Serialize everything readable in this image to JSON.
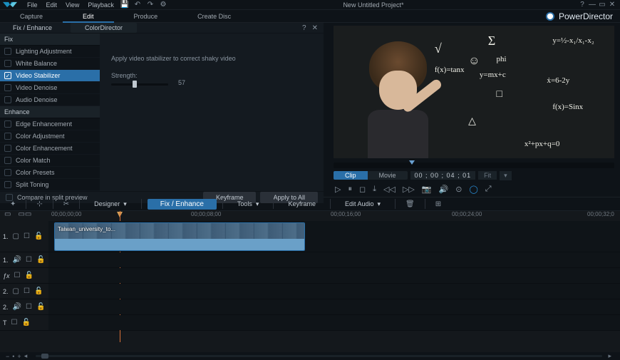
{
  "menu": {
    "items": [
      "File",
      "Edit",
      "View",
      "Playback"
    ],
    "title": "New Untitled Project*"
  },
  "tabs": {
    "items": [
      "Capture",
      "Edit",
      "Produce",
      "Create Disc"
    ],
    "activeIndex": 1,
    "brand": "PowerDirector"
  },
  "panel": {
    "title": "Fix / Enhance",
    "tab2": "ColorDirector",
    "sections": {
      "fix": {
        "title": "Fix",
        "items": [
          "Lighting Adjustment",
          "White Balance",
          "Video Stabilizer",
          "Video Denoise",
          "Audio Denoise"
        ],
        "checkedIndex": 2,
        "selectedIndex": 2
      },
      "enhance": {
        "title": "Enhance",
        "items": [
          "Edge Enhancement",
          "Color Adjustment",
          "Color Enhancement",
          "Color Match",
          "Color Presets",
          "Split Toning"
        ]
      }
    },
    "options": {
      "desc": "Apply video stabilizer to correct shaky video",
      "strengthLabel": "Strength:",
      "strengthValue": "57"
    },
    "footer": {
      "compare": "Compare in split preview",
      "keyframe": "Keyframe",
      "applyAll": "Apply to All"
    }
  },
  "preview": {
    "equations": [
      "y=mx+c",
      "f(x)=tanx",
      "y=½-x₁/x₁-x₂",
      "√",
      "Σ",
      "phi",
      "ẋ=6-2y",
      "f(x)=Sinx",
      "x²+px+q=0",
      "☺",
      "□",
      "△"
    ],
    "clip": "Clip",
    "movie": "Movie",
    "timecode": "00 ; 00 ; 04 ; 01",
    "fit": "Fit",
    "dropdown": "▾"
  },
  "toolbar": {
    "designer": "Designer",
    "fixEnhance": "Fix / Enhance",
    "tools": "Tools",
    "keyframe": "Keyframe",
    "editAudio": "Edit Audio"
  },
  "timeline": {
    "ticks": [
      "00;00;00;00",
      "00;00;08;00",
      "00;00;16;00",
      "00;00;24;00",
      "00;00;32;0"
    ],
    "clipName": "Taiwan_university_to...",
    "tracks": [
      {
        "id": "1.",
        "icon": "▢"
      },
      {
        "id": "1.",
        "icon": "🔊"
      },
      {
        "id": "fx",
        "icon": ""
      },
      {
        "id": "2.",
        "icon": "▢"
      },
      {
        "id": "2.",
        "icon": "🔊"
      },
      {
        "id": "T",
        "icon": ""
      }
    ]
  }
}
